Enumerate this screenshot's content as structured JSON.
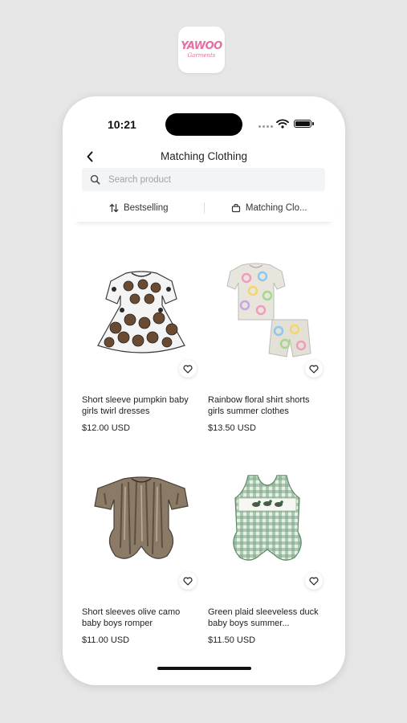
{
  "brand": {
    "logo_text": "YAWOO",
    "logo_subtext": "Garments"
  },
  "status_bar": {
    "time": "10:21"
  },
  "header": {
    "title": "Matching Clothing",
    "back_icon": "chevron-left-icon"
  },
  "search": {
    "placeholder": "Search product",
    "value": ""
  },
  "filters": [
    {
      "label": "Bestselling",
      "icon": "sort-icon"
    },
    {
      "label": "Matching Clo...",
      "icon": "collection-icon"
    }
  ],
  "products": [
    {
      "name": "Short sleeve pumpkin baby girls twirl dresses",
      "price": "$12.00 USD"
    },
    {
      "name": "Rainbow floral shirt shorts girls summer clothes",
      "price": "$13.50 USD"
    },
    {
      "name": "Short sleeves olive camo baby boys romper",
      "price": "$11.00 USD"
    },
    {
      "name": "Green plaid sleeveless duck baby boys summer...",
      "price": "$11.50 USD"
    }
  ],
  "colors": {
    "background": "#e6e6e6",
    "brand_pink": "#e46fa0",
    "text": "#222222",
    "placeholder": "#a3a3a3",
    "search_bg": "#f3f4f6"
  }
}
